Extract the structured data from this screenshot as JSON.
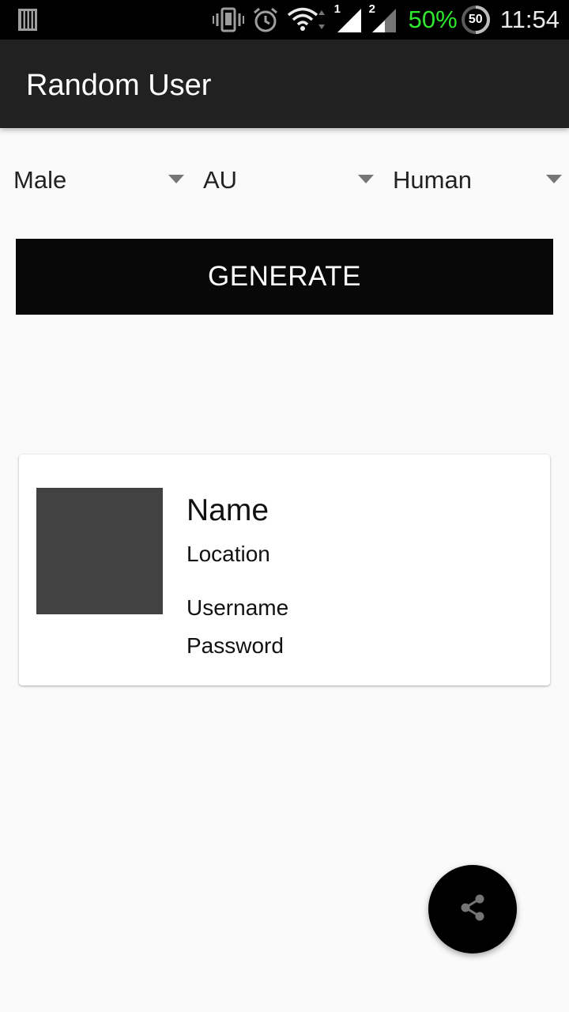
{
  "status_bar": {
    "battery_percent": "50%",
    "battery_badge": "50",
    "time": "11:54",
    "sim1_label": "1",
    "sim2_label": "2",
    "icons": [
      "sim-card-icon",
      "vibrate-icon",
      "alarm-icon",
      "wifi-icon",
      "signal-sim1-icon",
      "signal-sim2-icon",
      "battery-saver-icon"
    ],
    "battery_color": "#2ee82e"
  },
  "toolbar": {
    "title": "Random User",
    "background": "#212121"
  },
  "filters": {
    "gender": {
      "selected": "Male"
    },
    "nationality": {
      "selected": "AU"
    },
    "type": {
      "selected": "Human"
    }
  },
  "generate_button": {
    "label": "GENERATE",
    "background": "#080808"
  },
  "user_card": {
    "name": "Name",
    "location": "Location",
    "username": "Username",
    "password": "Password"
  },
  "fab": {
    "icon": "share-icon"
  }
}
